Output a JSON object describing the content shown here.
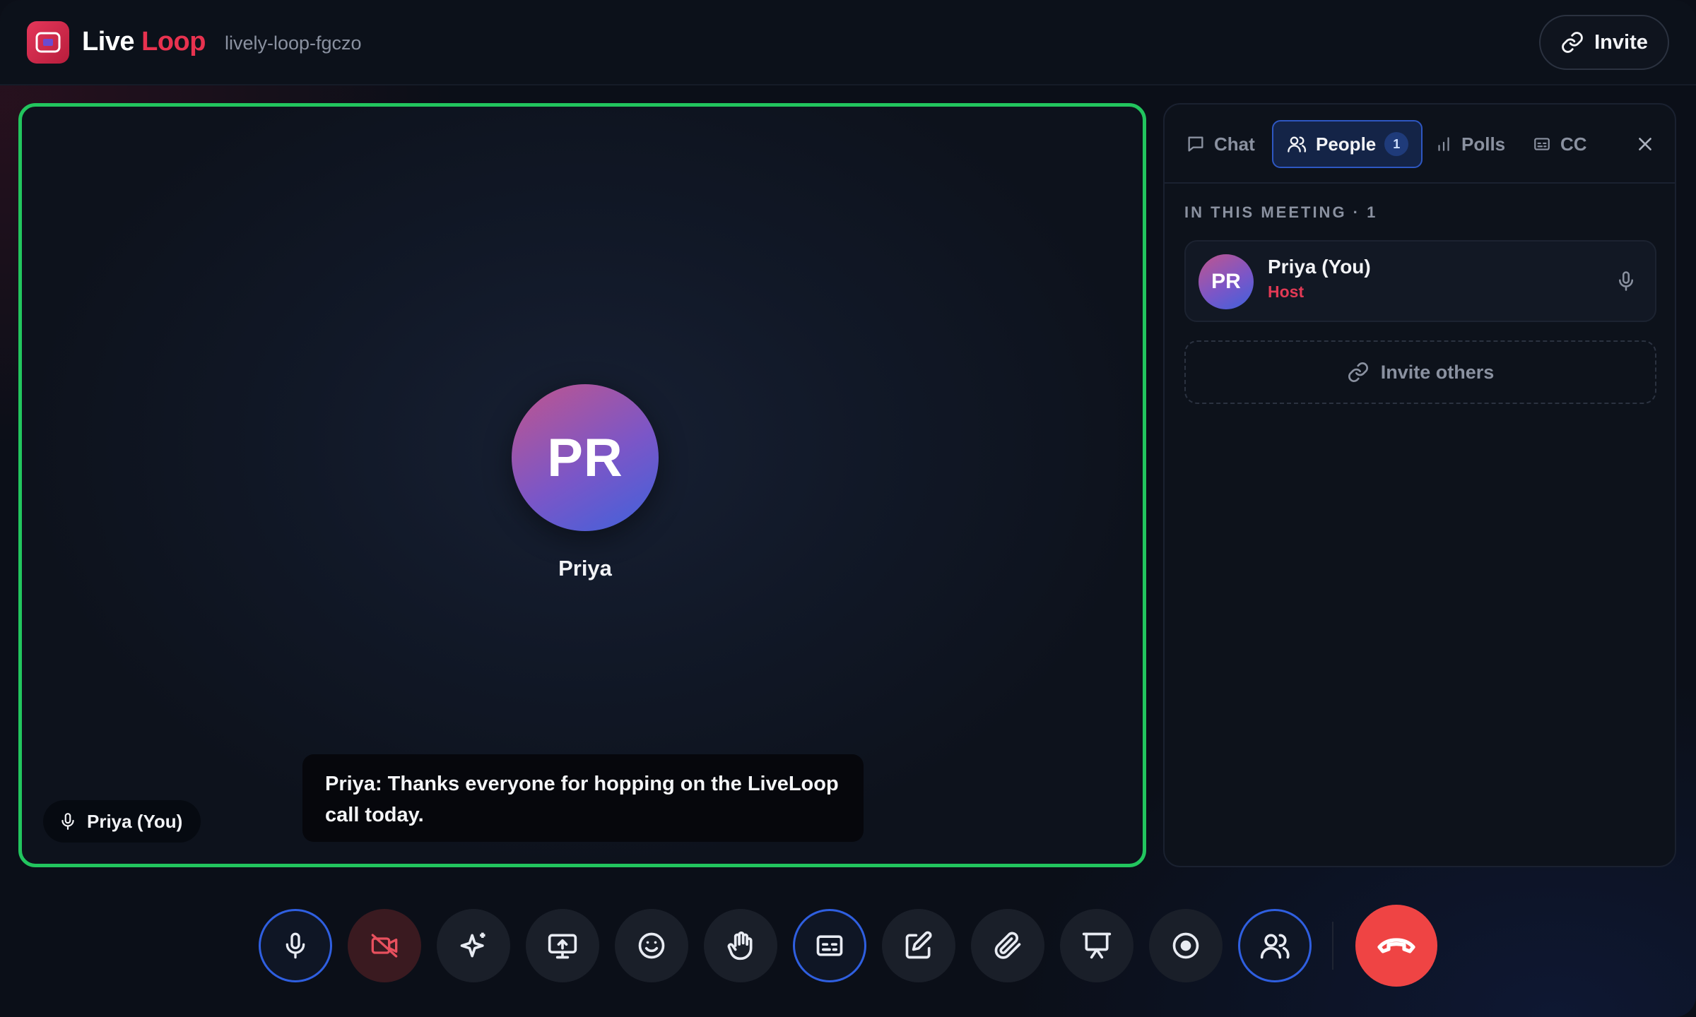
{
  "header": {
    "brand_word1": "Live",
    "brand_word2": "Loop",
    "room_code": "lively-loop-fgczo",
    "invite_label": "Invite",
    "logo_icon": "video-window-icon"
  },
  "stage": {
    "speaker_initials": "PR",
    "speaker_name": "Priya",
    "name_tag": "Priya (You)",
    "caption": "Priya: Thanks everyone for hopping on the LiveLoop call today.",
    "active_border_color": "#22c55e"
  },
  "panel": {
    "tabs": [
      {
        "label": "Chat",
        "icon": "chat-bubble-icon",
        "active": false
      },
      {
        "label": "People",
        "icon": "users-icon",
        "active": true,
        "count": "1"
      },
      {
        "label": "Polls",
        "icon": "bar-chart-icon",
        "active": false
      },
      {
        "label": "CC",
        "icon": "captions-icon",
        "active": false
      }
    ],
    "section_title": "IN THIS MEETING · 1",
    "participants": [
      {
        "initials": "PR",
        "name": "Priya (You)",
        "role": "Host",
        "mic": "on"
      }
    ],
    "invite_others_label": "Invite others"
  },
  "toolbar": {
    "controls": [
      {
        "name": "mic",
        "icon": "microphone-icon",
        "state": "on"
      },
      {
        "name": "camera",
        "icon": "camera-off-icon",
        "state": "off"
      },
      {
        "name": "effects",
        "icon": "sparkles-icon"
      },
      {
        "name": "share-screen",
        "icon": "screen-share-icon"
      },
      {
        "name": "reactions",
        "icon": "smiley-icon"
      },
      {
        "name": "raise-hand",
        "icon": "hand-icon"
      },
      {
        "name": "captions",
        "icon": "captions-icon",
        "state": "on"
      },
      {
        "name": "whiteboard",
        "icon": "edit-icon"
      },
      {
        "name": "attach",
        "icon": "paperclip-icon"
      },
      {
        "name": "present",
        "icon": "presentation-icon"
      },
      {
        "name": "record",
        "icon": "record-icon"
      },
      {
        "name": "participants",
        "icon": "users-icon",
        "state": "on"
      }
    ],
    "end_call_icon": "phone-hangup-icon",
    "colors": {
      "accent": "#2f5fe0",
      "end_call": "#ef4444",
      "brand": "#e8324f"
    }
  }
}
